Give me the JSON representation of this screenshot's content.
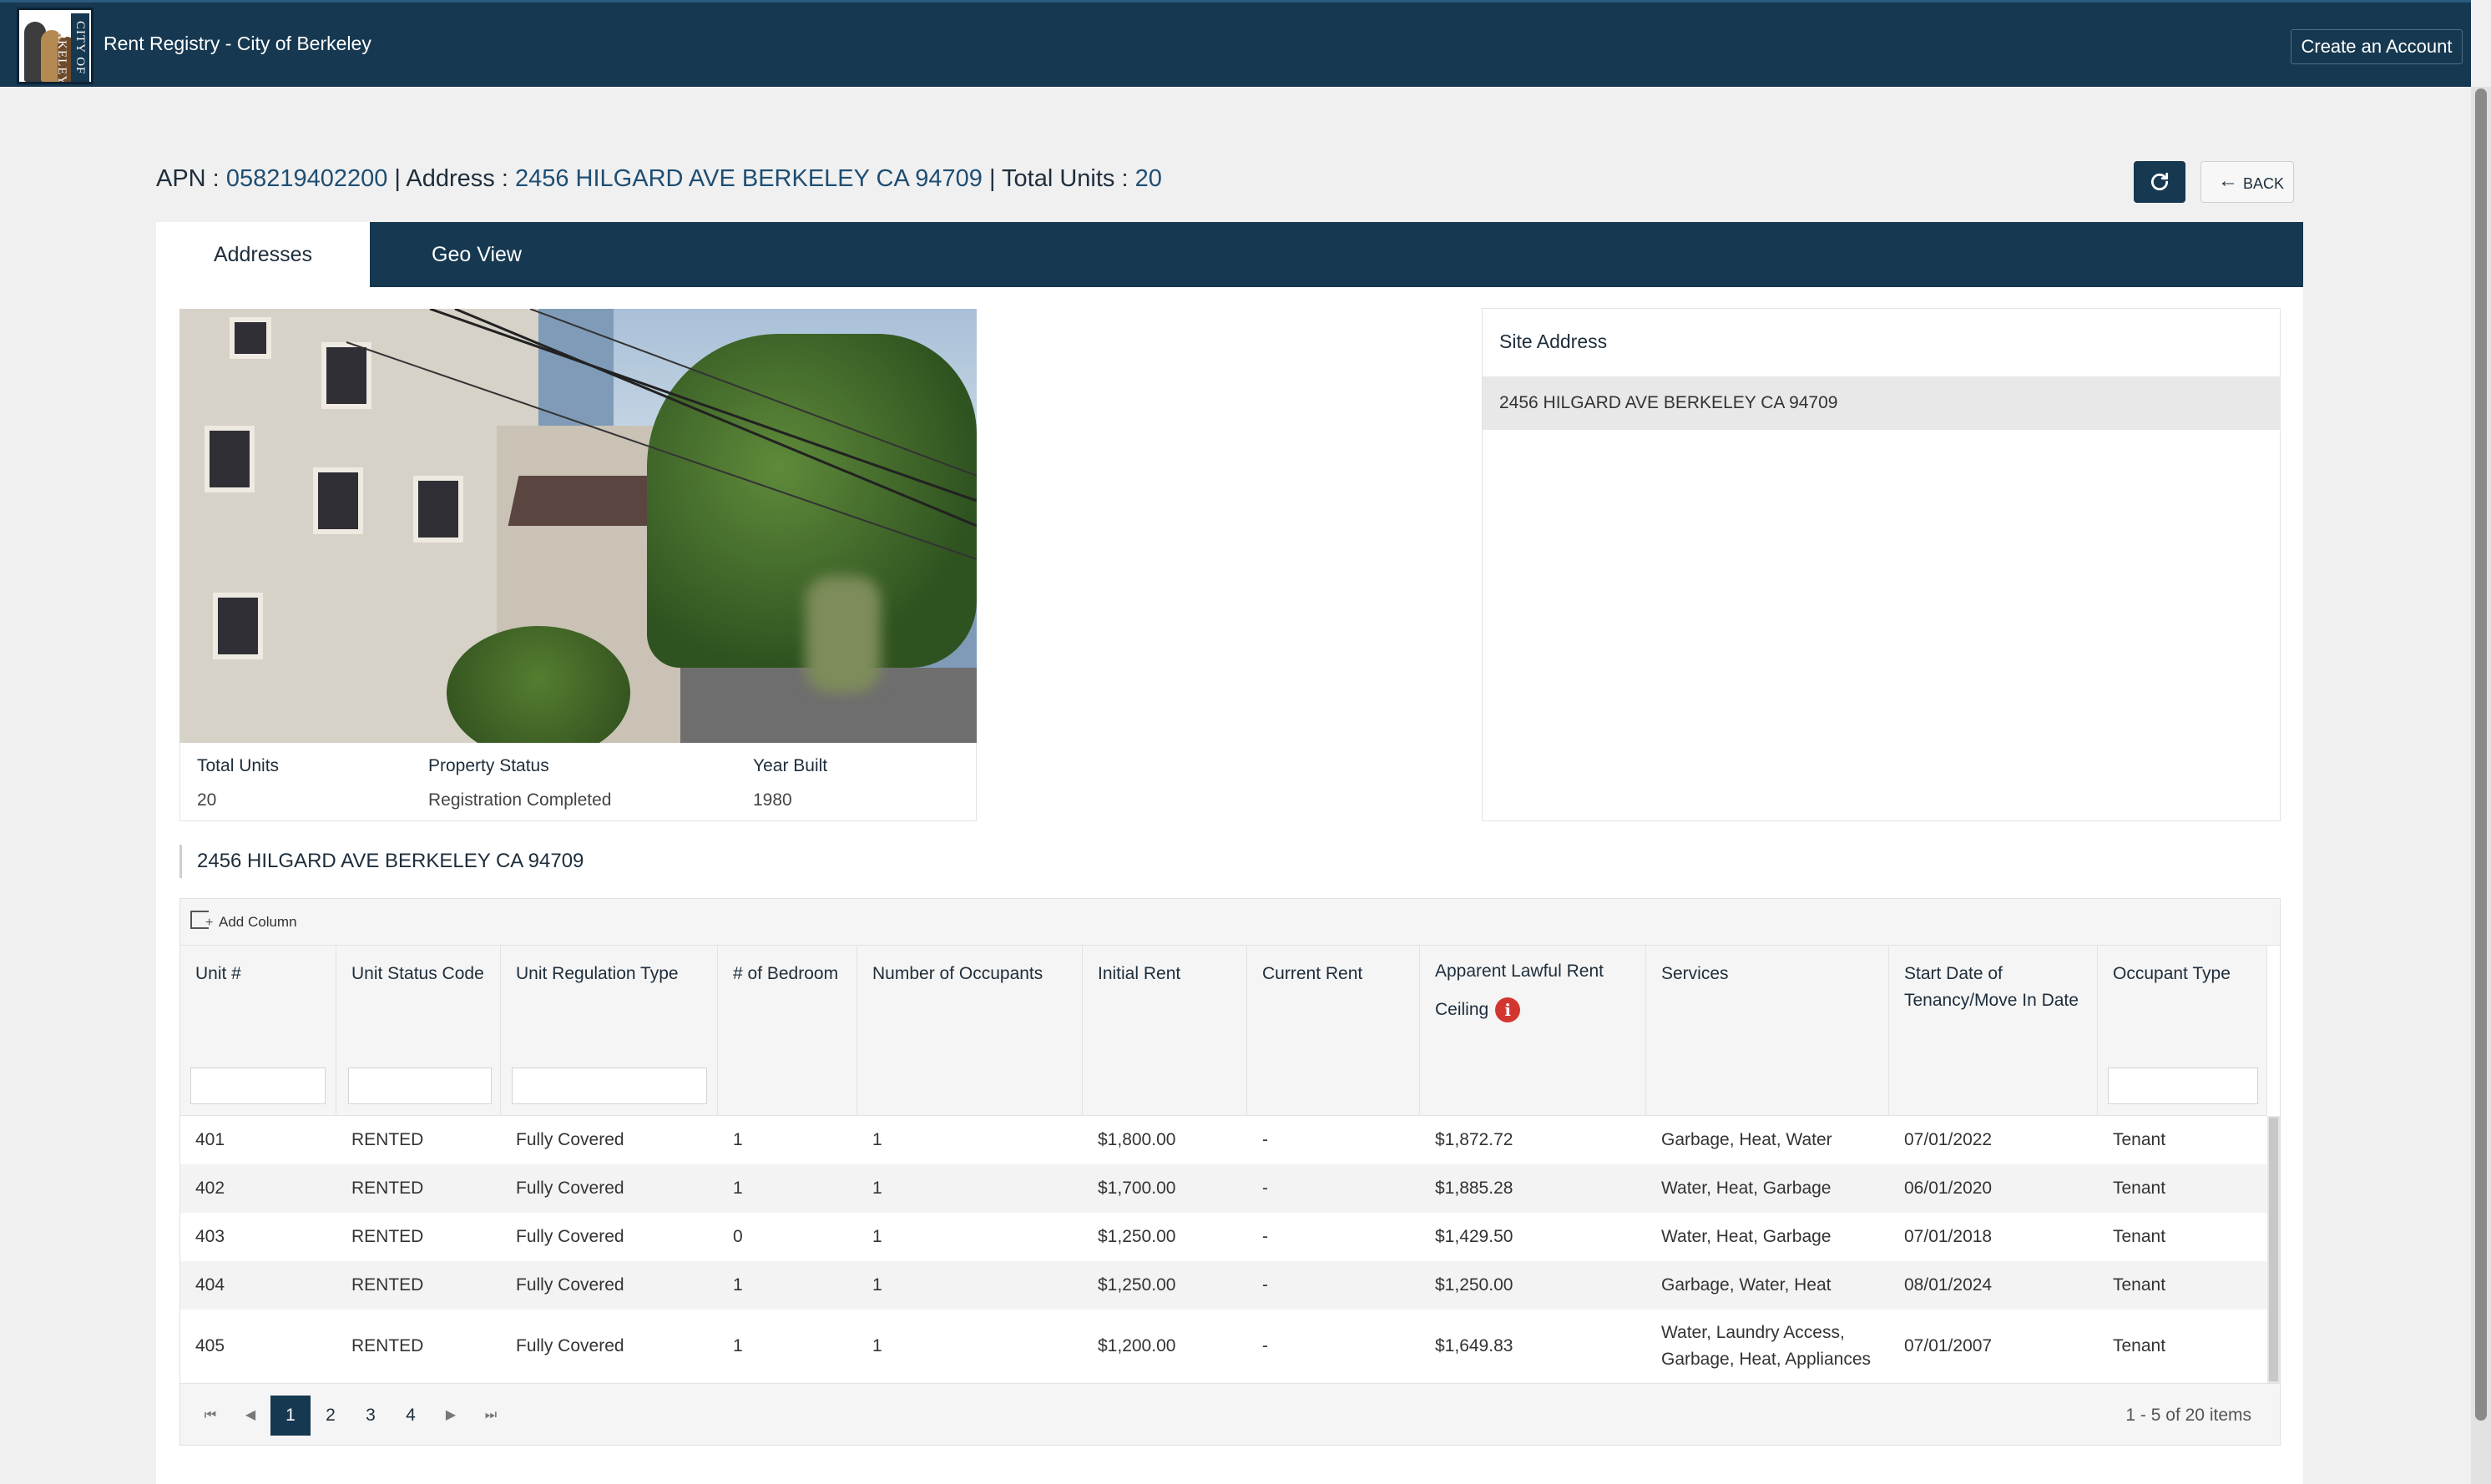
{
  "topbar": {
    "logo_text": "CITY OF BERKELEY",
    "app_title": "Rent Registry - City of Berkeley",
    "create_account": "Create an Account"
  },
  "header": {
    "apn_label": "APN : ",
    "apn": "058219402200",
    "sep1": " |  ",
    "address_label": "Address : ",
    "address": "2456 HILGARD AVE BERKELEY CA 94709",
    "sep2": " |  ",
    "units_label": "Total Units : ",
    "units": "20",
    "back_label": "BACK",
    "back_icon": "arrow-left-icon",
    "refresh_icon": "refresh-icon"
  },
  "tabs": [
    {
      "label": "Addresses",
      "active": true
    },
    {
      "label": "Geo View",
      "active": false
    }
  ],
  "property": {
    "total_units_label": "Total Units",
    "total_units": "20",
    "status_label": "Property Status",
    "status": "Registration Completed",
    "year_label": "Year Built",
    "year": "1980"
  },
  "site": {
    "title": "Site Address",
    "address": "2456 HILGARD AVE BERKELEY CA 94709"
  },
  "section_heading": "2456 HILGARD AVE BERKELEY CA 94709",
  "grid": {
    "add_column": "Add Column",
    "columns": [
      "Unit #",
      "Unit Status Code",
      "Unit Regulation Type",
      "# of Bedroom",
      "Number of Occupants",
      "Initial Rent",
      "Current Rent",
      "Apparent Lawful Rent Ceiling",
      "Services",
      "Start Date of Tenancy/Move In Date",
      "Occupant Type"
    ],
    "rows": [
      [
        "401",
        "RENTED",
        "Fully Covered",
        "1",
        "1",
        "$1,800.00",
        "-",
        "$1,872.72",
        "Garbage, Heat, Water",
        "07/01/2022",
        "Tenant"
      ],
      [
        "402",
        "RENTED",
        "Fully Covered",
        "1",
        "1",
        "$1,700.00",
        "-",
        "$1,885.28",
        "Water, Heat, Garbage",
        "06/01/2020",
        "Tenant"
      ],
      [
        "403",
        "RENTED",
        "Fully Covered",
        "0",
        "1",
        "$1,250.00",
        "-",
        "$1,429.50",
        "Water, Heat, Garbage",
        "07/01/2018",
        "Tenant"
      ],
      [
        "404",
        "RENTED",
        "Fully Covered",
        "1",
        "1",
        "$1,250.00",
        "-",
        "$1,250.00",
        "Garbage, Water, Heat",
        "08/01/2024",
        "Tenant"
      ],
      [
        "405",
        "RENTED",
        "Fully Covered",
        "1",
        "1",
        "$1,200.00",
        "-",
        "$1,649.83",
        "Water, Laundry Access, Garbage, Heat, Appliances",
        "07/01/2007",
        "Tenant"
      ]
    ],
    "pages": [
      "1",
      "2",
      "3",
      "4"
    ],
    "current_page": "1",
    "pager_info": "1 - 5 of 20 items",
    "nav_icons": {
      "first": "⏮",
      "prev": "◀",
      "next": "▶",
      "last": "⏭"
    }
  },
  "colors": {
    "navy": "#163851",
    "accent_link": "#1e4e73",
    "info_red": "#d3362f"
  }
}
